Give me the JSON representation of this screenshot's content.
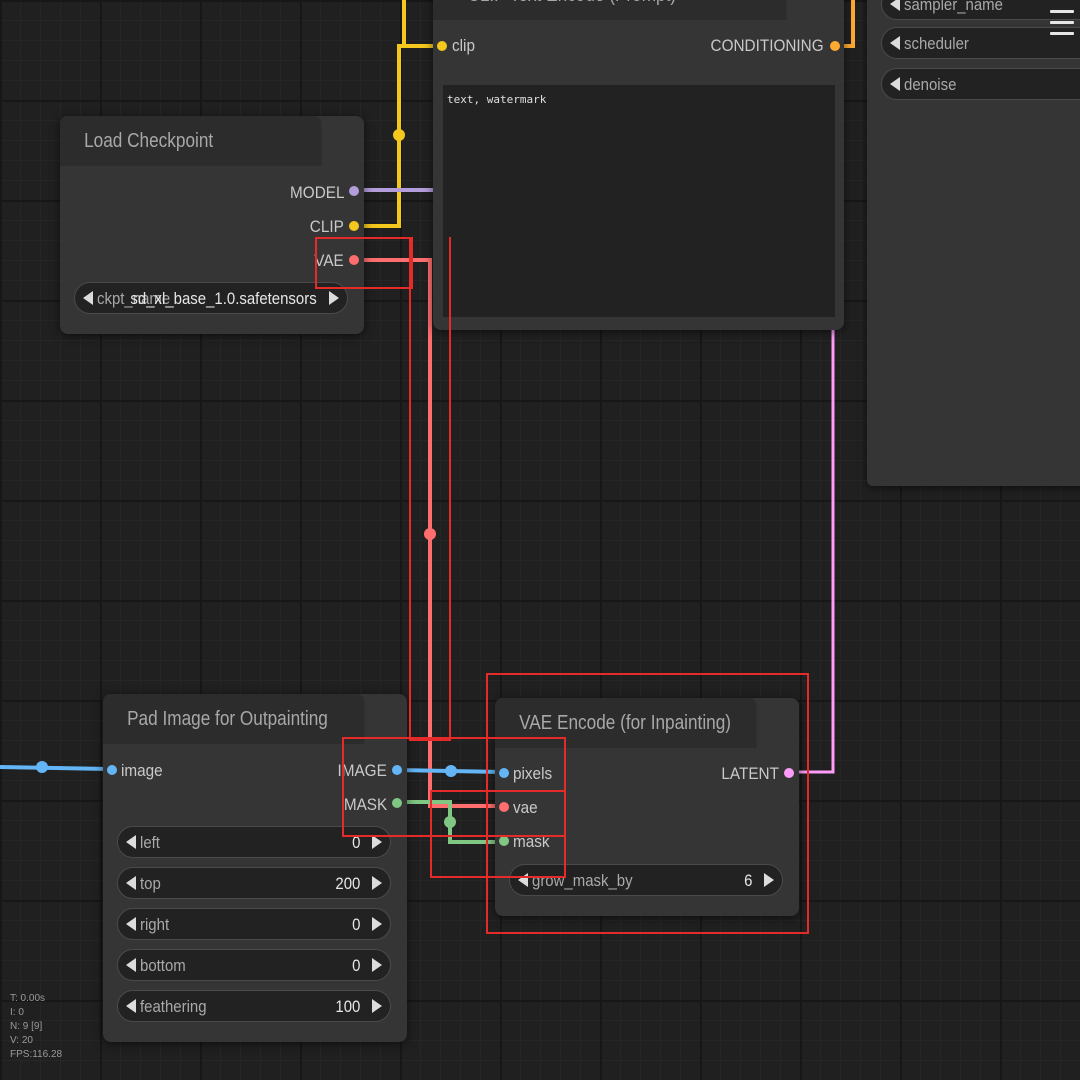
{
  "colors": {
    "clip": "#f4c81c",
    "model": "#b39ddb",
    "vae": "#ff6e6e",
    "image": "#64b5f6",
    "mask": "#81c784",
    "latent": "#ff9cf9",
    "conditioning": "#ffa931",
    "highlight": "#e52a2a"
  },
  "clip_text_encode": {
    "title": "CLIP Text Encode (Prompt)",
    "input_clip": "clip",
    "output_conditioning": "CONDITIONING",
    "text": "text, watermark"
  },
  "sampler_panel": {
    "widgets": [
      {
        "name": "sampler_name"
      },
      {
        "name": "scheduler"
      },
      {
        "name": "denoise"
      }
    ]
  },
  "load_checkpoint": {
    "title": "Load Checkpoint",
    "outputs": [
      "MODEL",
      "CLIP",
      "VAE"
    ],
    "ckpt_name_label": "ckpt_name",
    "ckpt_name_value": "sd_xl_base_1.0.safetensors"
  },
  "pad_image": {
    "title": "Pad Image for Outpainting",
    "input_image": "image",
    "outputs": [
      "IMAGE",
      "MASK"
    ],
    "widgets": [
      {
        "name": "left",
        "value": "0"
      },
      {
        "name": "top",
        "value": "200"
      },
      {
        "name": "right",
        "value": "0"
      },
      {
        "name": "bottom",
        "value": "0"
      },
      {
        "name": "feathering",
        "value": "100"
      }
    ]
  },
  "vae_encode": {
    "title": "VAE Encode (for Inpainting)",
    "inputs": [
      "pixels",
      "vae",
      "mask"
    ],
    "output_latent": "LATENT",
    "grow_mask_label": "grow_mask_by",
    "grow_mask_value": "6"
  },
  "stats": {
    "t": "T: 0.00s",
    "i": "I: 0",
    "n": "N: 9 [9]",
    "v": "V: 20",
    "fps": "FPS:116.28"
  }
}
